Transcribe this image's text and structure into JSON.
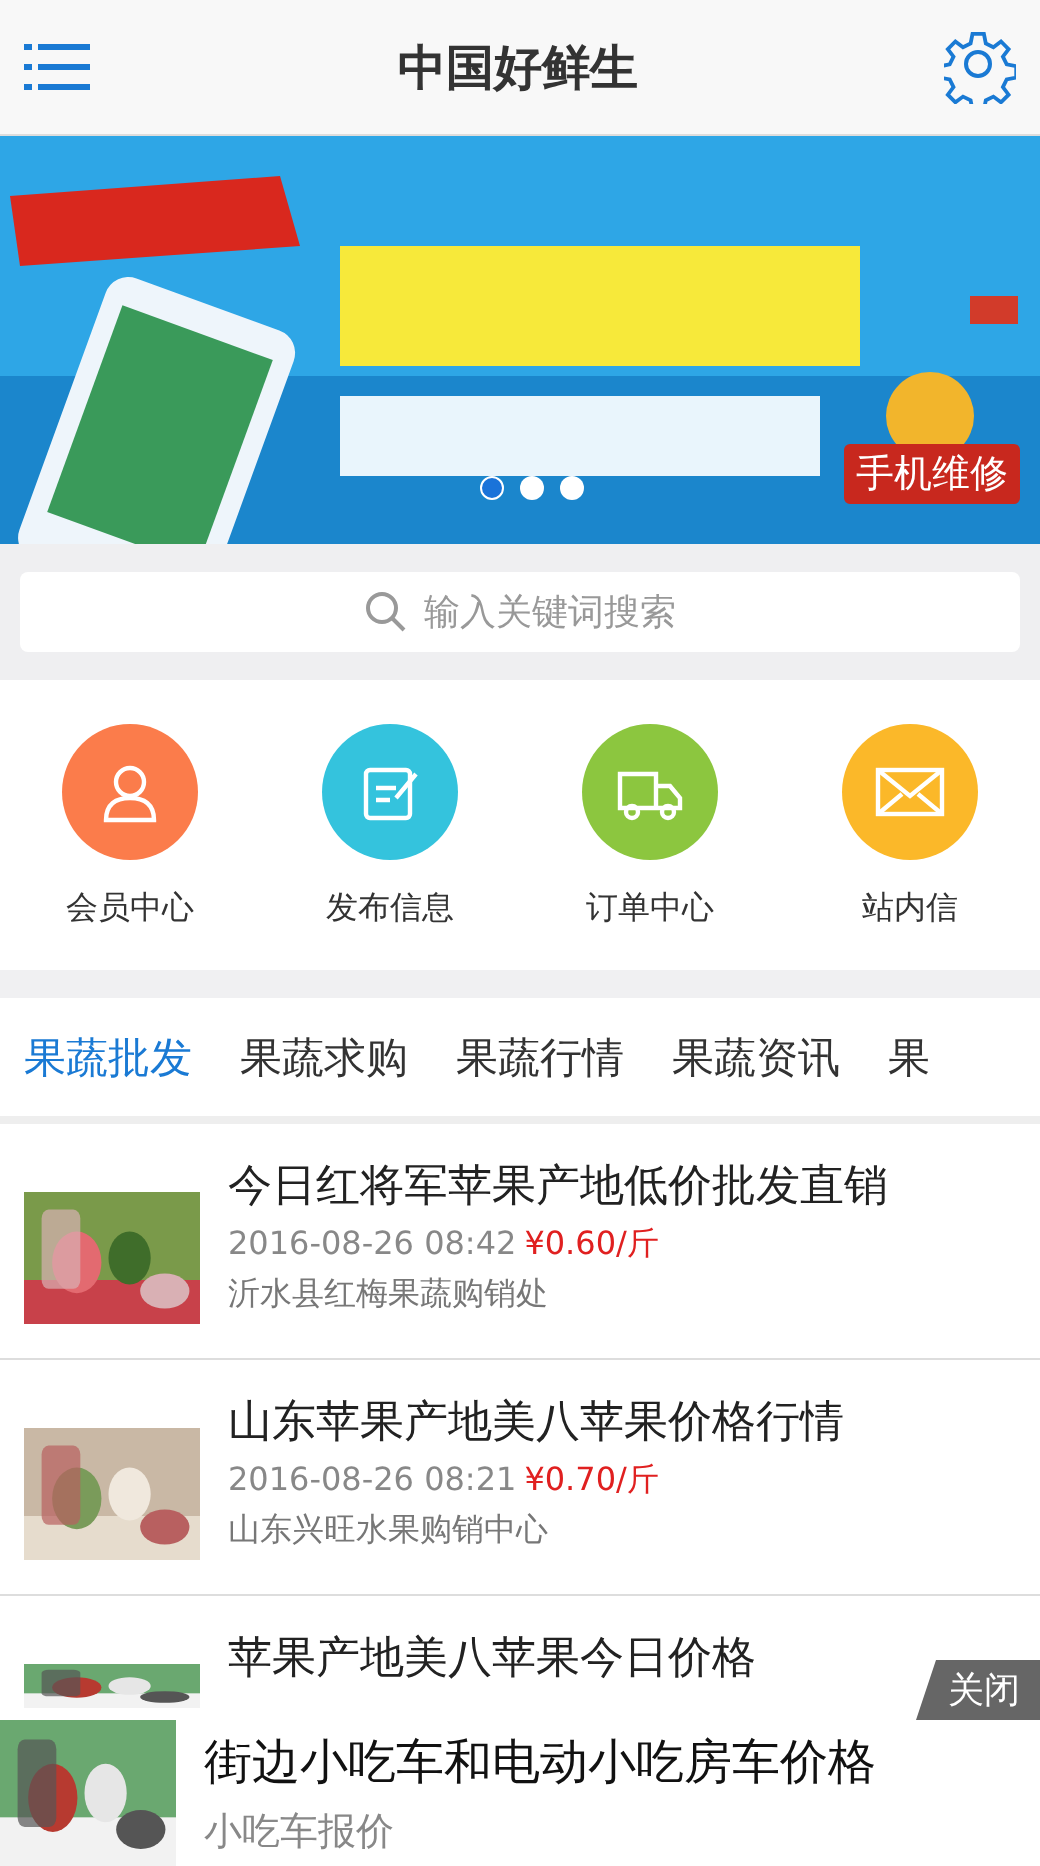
{
  "header": {
    "title": "中国好鲜生"
  },
  "banner": {
    "badge": "手机维修",
    "dots": [
      {
        "selected": true
      },
      {
        "selected": false
      },
      {
        "selected": false
      }
    ]
  },
  "search": {
    "placeholder": "输入关键词搜索"
  },
  "shortcuts": [
    {
      "label": "会员中心",
      "kind": "user",
      "color": "#fb7c4b"
    },
    {
      "label": "发布信息",
      "kind": "edit",
      "color": "#34c3dd"
    },
    {
      "label": "订单中心",
      "kind": "truck",
      "color": "#8cc63f"
    },
    {
      "label": "站内信",
      "kind": "mail",
      "color": "#fbb829"
    }
  ],
  "tabs": [
    {
      "label": "果蔬批发",
      "selected": true
    },
    {
      "label": "果蔬求购",
      "selected": false
    },
    {
      "label": "果蔬行情",
      "selected": false
    },
    {
      "label": "果蔬资讯",
      "selected": false
    },
    {
      "label": "果",
      "selected": false
    }
  ],
  "listings": [
    {
      "title": "今日红将军苹果产地低价批发直销",
      "date": "2016-08-26 08:42",
      "price": "¥0.60/斤",
      "seller": "沂水县红梅果蔬购销处"
    },
    {
      "title": "山东苹果产地美八苹果价格行情",
      "date": "2016-08-26 08:21",
      "price": "¥0.70/斤",
      "seller": "山东兴旺水果购销中心"
    },
    {
      "title": "苹果产地美八苹果今日价格"
    }
  ],
  "ad": {
    "close": "关闭",
    "title": "街边小吃车和电动小吃房车价格",
    "subtitle": "小吃车报价"
  }
}
